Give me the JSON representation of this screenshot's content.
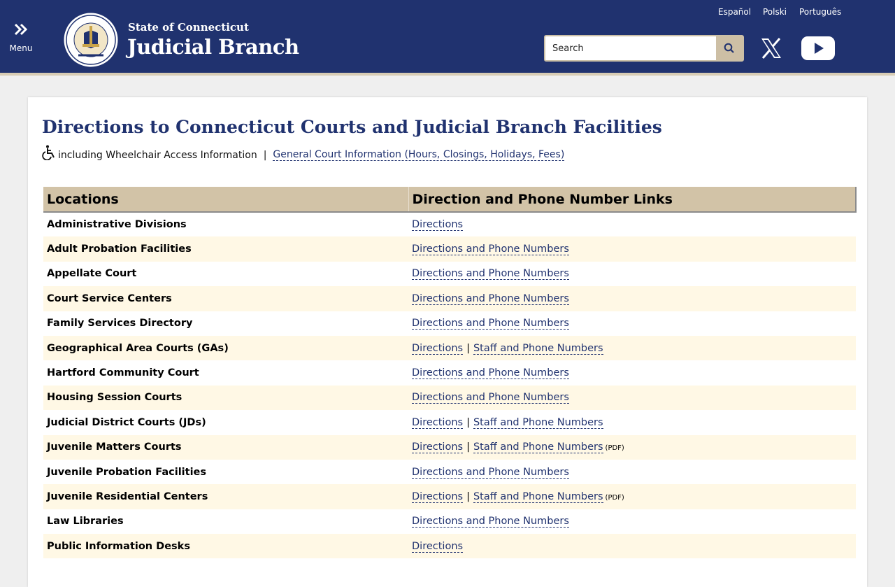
{
  "header": {
    "menu_label": "Menu",
    "brand_top": "State of Connecticut",
    "brand_main": "Judicial Branch",
    "languages": [
      "Español",
      "Polski",
      "Português"
    ],
    "search_placeholder": "Search",
    "colors": {
      "header_bg": "#20326f",
      "accent_tan": "#cdbfa5"
    }
  },
  "page": {
    "title": "Directions to Connecticut Courts and Judicial Branch Facilities",
    "wheelchair_text": "including Wheelchair Access Information",
    "separator": "|",
    "general_info_link": "General Court Information (Hours, Closings, Holidays, Fees)"
  },
  "table": {
    "headers": [
      "Locations",
      "Direction and Phone Number Links"
    ],
    "rows": [
      {
        "location": "Administrative Divisions",
        "links": [
          "Directions"
        ],
        "pdf": ""
      },
      {
        "location": "Adult Probation Facilities",
        "links": [
          "Directions and Phone Numbers"
        ],
        "pdf": ""
      },
      {
        "location": "Appellate Court",
        "links": [
          "Directions and Phone Numbers"
        ],
        "pdf": ""
      },
      {
        "location": "Court Service Centers",
        "links": [
          "Directions and Phone Numbers"
        ],
        "pdf": ""
      },
      {
        "location": "Family Services Directory",
        "links": [
          "Directions and Phone Numbers"
        ],
        "pdf": ""
      },
      {
        "location": "Geographical Area Courts (GAs)",
        "links": [
          "Directions",
          "Staff and Phone Numbers"
        ],
        "pdf": ""
      },
      {
        "location": "Hartford Community Court",
        "links": [
          "Directions and Phone Numbers"
        ],
        "pdf": ""
      },
      {
        "location": "Housing Session Courts",
        "links": [
          "Directions and Phone Numbers"
        ],
        "pdf": ""
      },
      {
        "location": "Judicial District Courts (JDs)",
        "links": [
          "Directions",
          "Staff and Phone Numbers"
        ],
        "pdf": ""
      },
      {
        "location": "Juvenile Matters Courts",
        "links": [
          "Directions",
          "Staff and Phone Numbers"
        ],
        "pdf": "(PDF)"
      },
      {
        "location": "Juvenile Probation Facilities",
        "links": [
          "Directions and Phone Numbers"
        ],
        "pdf": ""
      },
      {
        "location": "Juvenile Residential Centers",
        "links": [
          "Directions",
          "Staff and Phone Numbers"
        ],
        "pdf": "(PDF)"
      },
      {
        "location": "Law Libraries",
        "links": [
          "Directions and Phone Numbers"
        ],
        "pdf": ""
      },
      {
        "location": "Public Information Desks",
        "links": [
          "Directions"
        ],
        "pdf": ""
      }
    ]
  }
}
